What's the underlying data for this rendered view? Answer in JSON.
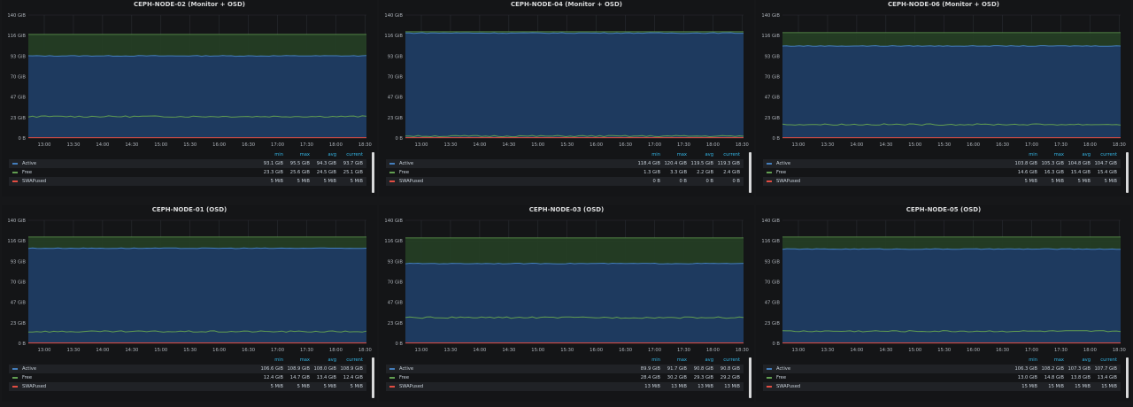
{
  "ui": {
    "legend_headers": [
      "min",
      "max",
      "avg",
      "current"
    ]
  },
  "colors": {
    "background": "#161719",
    "panel": "#141517",
    "grid": "#2a2d33",
    "axis_text": "#aeb3ba",
    "legend_header": "#33b5e5"
  },
  "chart_data": [
    {
      "title": "CEPH-NODE-02 (Monitor + OSD)",
      "type": "area",
      "y_ticks": [
        "0 B",
        "23 GiB",
        "47 GiB",
        "70 GiB",
        "93 GiB",
        "116 GiB",
        "140 GiB"
      ],
      "ylim": [
        0,
        140
      ],
      "x_ticks": [
        "13:00",
        "13:30",
        "14:00",
        "14:30",
        "15:00",
        "15:30",
        "16:00",
        "16:30",
        "17:00",
        "17:30",
        "18:00",
        "18:30"
      ],
      "stack_top": 118,
      "series": [
        {
          "name": "Active",
          "color": "#447ebc",
          "fill": "#1e3a5f",
          "level": 93.5,
          "min": "93.1 GiB",
          "max": "95.5 GiB",
          "avg": "94.3 GiB",
          "current": "93.7 GiB"
        },
        {
          "name": "Free",
          "color": "#629e51",
          "fill": "#243d24",
          "level": 24.5,
          "min": "23.3 GiB",
          "max": "25.6 GiB",
          "avg": "24.5 GiB",
          "current": "25.1 GiB"
        },
        {
          "name": "SWAPused",
          "color": "#e24d42",
          "level": 0,
          "min": "5 MiB",
          "max": "5 MiB",
          "avg": "5 MiB",
          "current": "5 MiB"
        }
      ]
    },
    {
      "title": "CEPH-NODE-04 (Monitor + OSD)",
      "type": "area",
      "y_ticks": [
        "0 B",
        "23 GiB",
        "47 GiB",
        "70 GiB",
        "93 GiB",
        "116 GiB",
        "140 GiB"
      ],
      "ylim": [
        0,
        140
      ],
      "x_ticks": [
        "13:00",
        "13:30",
        "14:00",
        "14:30",
        "15:00",
        "15:30",
        "16:00",
        "16:30",
        "17:00",
        "17:30",
        "18:00",
        "18:30"
      ],
      "stack_top": 121,
      "series": [
        {
          "name": "Active",
          "color": "#447ebc",
          "fill": "#1e3a5f",
          "level": 119.5,
          "min": "118.4 GiB",
          "max": "120.4 GiB",
          "avg": "119.5 GiB",
          "current": "119.3 GiB"
        },
        {
          "name": "Free",
          "color": "#629e51",
          "fill": "#243d24",
          "level": 2.2,
          "min": "1.3 GiB",
          "max": "3.3 GiB",
          "avg": "2.2 GiB",
          "current": "2.4 GiB"
        },
        {
          "name": "SWAPused",
          "color": "#e24d42",
          "level": 0,
          "min": "0 B",
          "max": "0 B",
          "avg": "0 B",
          "current": "0 B"
        }
      ]
    },
    {
      "title": "CEPH-NODE-06 (Monitor + OSD)",
      "type": "area",
      "y_ticks": [
        "0 B",
        "23 GiB",
        "47 GiB",
        "70 GiB",
        "93 GiB",
        "116 GiB",
        "140 GiB"
      ],
      "ylim": [
        0,
        140
      ],
      "x_ticks": [
        "13:00",
        "13:30",
        "14:00",
        "14:30",
        "15:00",
        "15:30",
        "16:00",
        "16:30",
        "17:00",
        "17:30",
        "18:00",
        "18:30"
      ],
      "stack_top": 120,
      "series": [
        {
          "name": "Active",
          "color": "#447ebc",
          "fill": "#1e3a5f",
          "level": 104.8,
          "min": "103.8 GiB",
          "max": "105.3 GiB",
          "avg": "104.8 GiB",
          "current": "104.7 GiB"
        },
        {
          "name": "Free",
          "color": "#629e51",
          "fill": "#243d24",
          "level": 15.4,
          "min": "14.6 GiB",
          "max": "16.3 GiB",
          "avg": "15.4 GiB",
          "current": "15.4 GiB"
        },
        {
          "name": "SWAPused",
          "color": "#e24d42",
          "level": 0,
          "min": "5 MiB",
          "max": "5 MiB",
          "avg": "5 MiB",
          "current": "5 MiB"
        }
      ]
    },
    {
      "title": "CEPH-NODE-01 (OSD)",
      "type": "area",
      "y_ticks": [
        "0 B",
        "23 GiB",
        "47 GiB",
        "70 GiB",
        "93 GiB",
        "116 GiB",
        "140 GiB"
      ],
      "ylim": [
        0,
        140
      ],
      "x_ticks": [
        "13:00",
        "13:30",
        "14:00",
        "14:30",
        "15:00",
        "15:30",
        "16:00",
        "16:30",
        "17:00",
        "17:30",
        "18:00",
        "18:30"
      ],
      "stack_top": 121,
      "series": [
        {
          "name": "Active",
          "color": "#447ebc",
          "fill": "#1e3a5f",
          "level": 108.2,
          "min": "106.6 GiB",
          "max": "108.9 GiB",
          "avg": "108.0 GiB",
          "current": "108.9 GiB"
        },
        {
          "name": "Free",
          "color": "#629e51",
          "fill": "#243d24",
          "level": 13.4,
          "min": "12.4 GiB",
          "max": "14.7 GiB",
          "avg": "13.4 GiB",
          "current": "12.4 GiB"
        },
        {
          "name": "SWAPused",
          "color": "#e24d42",
          "level": 0,
          "min": "5 MiB",
          "max": "5 MiB",
          "avg": "5 MiB",
          "current": "5 MiB"
        }
      ]
    },
    {
      "title": "CEPH-NODE-03 (OSD)",
      "type": "area",
      "y_ticks": [
        "0 B",
        "23 GiB",
        "47 GiB",
        "70 GiB",
        "93 GiB",
        "116 GiB",
        "140 GiB"
      ],
      "ylim": [
        0,
        140
      ],
      "x_ticks": [
        "13:00",
        "13:30",
        "14:00",
        "14:30",
        "15:00",
        "15:30",
        "16:00",
        "16:30",
        "17:00",
        "17:30",
        "18:00",
        "18:30"
      ],
      "stack_top": 120,
      "series": [
        {
          "name": "Active",
          "color": "#447ebc",
          "fill": "#1e3a5f",
          "level": 90.8,
          "min": "89.9 GiB",
          "max": "91.7 GiB",
          "avg": "90.8 GiB",
          "current": "90.8 GiB"
        },
        {
          "name": "Free",
          "color": "#629e51",
          "fill": "#243d24",
          "level": 29.3,
          "min": "28.4 GiB",
          "max": "30.2 GiB",
          "avg": "29.3 GiB",
          "current": "29.2 GiB"
        },
        {
          "name": "SWAPused",
          "color": "#e24d42",
          "level": 0,
          "min": "13 MiB",
          "max": "13 MiB",
          "avg": "13 MiB",
          "current": "13 MiB"
        }
      ]
    },
    {
      "title": "CEPH-NODE-05 (OSD)",
      "type": "area",
      "y_ticks": [
        "0 B",
        "23 GiB",
        "47 GiB",
        "70 GiB",
        "93 GiB",
        "116 GiB",
        "140 GiB"
      ],
      "ylim": [
        0,
        140
      ],
      "x_ticks": [
        "13:00",
        "13:30",
        "14:00",
        "14:30",
        "15:00",
        "15:30",
        "16:00",
        "16:30",
        "17:00",
        "17:30",
        "18:00",
        "18:30"
      ],
      "stack_top": 121,
      "series": [
        {
          "name": "Active",
          "color": "#447ebc",
          "fill": "#1e3a5f",
          "level": 107.3,
          "min": "106.3 GiB",
          "max": "108.2 GiB",
          "avg": "107.3 GiB",
          "current": "107.7 GiB"
        },
        {
          "name": "Free",
          "color": "#629e51",
          "fill": "#243d24",
          "level": 13.8,
          "min": "13.0 GiB",
          "max": "14.8 GiB",
          "avg": "13.8 GiB",
          "current": "13.4 GiB"
        },
        {
          "name": "SWAPused",
          "color": "#e24d42",
          "level": 0,
          "min": "15 MiB",
          "max": "15 MiB",
          "avg": "15 MiB",
          "current": "15 MiB"
        }
      ]
    }
  ]
}
